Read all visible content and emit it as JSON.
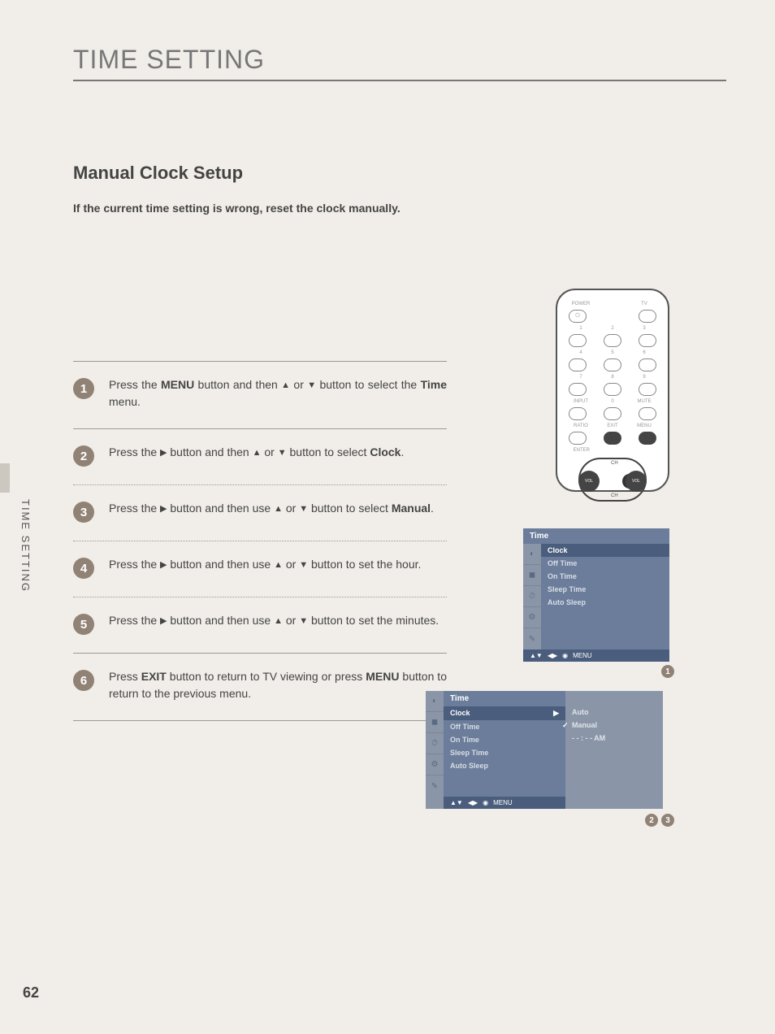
{
  "page_title": "TIME SETTING",
  "section_title": "Manual Clock Setup",
  "intro": "If the current time setting is wrong, reset the clock manually.",
  "side_tab": "TIME SETTING",
  "page_number": "62",
  "steps": [
    {
      "n": "1",
      "html": "Press the <b>MENU</b> button and then <span class='tri'>▲</span> or <span class='tri'>▼</span> button to select the <b>Time</b> menu."
    },
    {
      "n": "2",
      "html": "Press the <span class='tri'>▶</span> button and then <span class='tri'>▲</span> or <span class='tri'>▼</span> button to select <b>Clock</b>."
    },
    {
      "n": "3",
      "html": "Press the <span class='tri'>▶</span> button and then use <span class='tri'>▲</span> or <span class='tri'>▼</span> button to select <b>Manual</b>."
    },
    {
      "n": "4",
      "html": "Press the <span class='tri'>▶</span> button and then use <span class='tri'>▲</span> or <span class='tri'>▼</span> button to set the hour."
    },
    {
      "n": "5",
      "html": "Press the <span class='tri'>▶</span> button and then use <span class='tri'>▲</span> or <span class='tri'>▼</span> button to set the minutes."
    },
    {
      "n": "6",
      "html": "Press <b>EXIT</b> button to return to TV viewing or press <b>MENU</b> button to return to the previous menu."
    }
  ],
  "remote": {
    "labels": {
      "power": "POWER",
      "tv": "TV",
      "input": "INPUT",
      "mute": "MUTE",
      "ratio": "RATIO",
      "exit": "EXIT",
      "menu": "MENU",
      "enter": "ENTER",
      "vol": "VOL",
      "ch": "CH"
    },
    "digits": [
      "1",
      "2",
      "3",
      "4",
      "5",
      "6",
      "7",
      "8",
      "9",
      "0"
    ]
  },
  "osd1": {
    "title": "Time",
    "items": [
      "Clock",
      "Off Time",
      "On Time",
      "Sleep Time",
      "Auto Sleep"
    ],
    "footer_menu": "MENU",
    "badge": "1"
  },
  "osd2": {
    "title": "Time",
    "items": [
      "Clock",
      "Off Time",
      "On Time",
      "Sleep Time",
      "Auto Sleep"
    ],
    "sub": [
      "Auto",
      "Manual",
      "- - : - -  AM"
    ],
    "footer_menu": "MENU",
    "badges": [
      "2",
      "3"
    ]
  }
}
